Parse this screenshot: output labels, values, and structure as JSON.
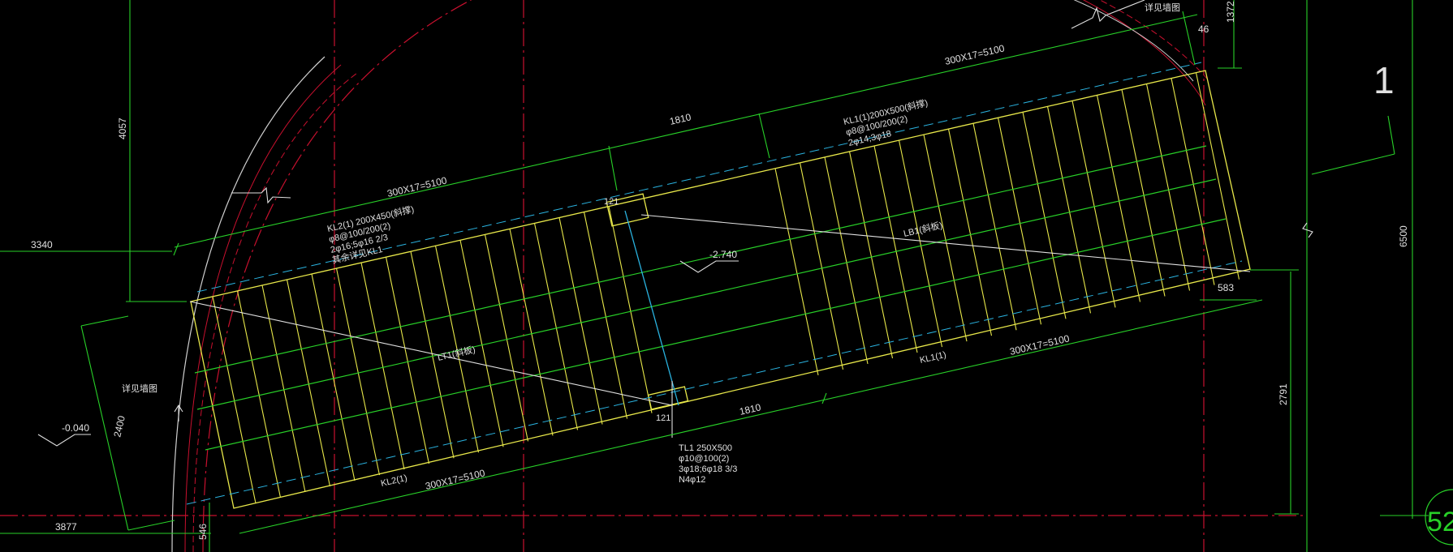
{
  "drawing": {
    "dimensions": {
      "top_overall": "300X17=5100",
      "top_segment": "1810",
      "bottom_overall": "300X17=5100",
      "bottom_segment": "1810",
      "lower_left_overall": "300X17=5100",
      "left_upper_height": "4057",
      "left_offset": "3340",
      "left_lower_offset": "3877",
      "left_slant": "2400",
      "bottom_small": "546",
      "right_small": "583",
      "right_height": "2791",
      "right_total_height": "6500",
      "top_right_small_1": "1372",
      "top_right_small_2": "46"
    },
    "beams": {
      "kl2_label": "KL2(1) 200X450(斜撑)",
      "kl2_line2": "φ8@100/200(2)",
      "kl2_line3": "2φ16;5φ16 2/3",
      "kl2_line4": "其余详见KL1",
      "kl1_label": "KL1(1)200X500(斜撑)",
      "kl1_line2": "φ8@100/200(2)",
      "kl1_line3": "2φ14;3φ18",
      "tl1_label": "TL1 250X500",
      "tl1_line2": "φ10@100(2)",
      "tl1_line3": "3φ18;6φ18 3/3",
      "tl1_line4": "N4φ12",
      "kl1_bottom": "KL1(1)",
      "kl2_bottom": "KL2(1)"
    },
    "markers": {
      "slab_label": "LB1(斜板)",
      "ladder_label": "LT1(斜板)",
      "step_top": "121",
      "step_bottom": "121",
      "elev_mid": "-2.740",
      "elev_left": "-0.040",
      "ref_left": "详见墙图",
      "ref_top": "详见墙图",
      "grid_1": "1",
      "grid_52": "52"
    }
  }
}
